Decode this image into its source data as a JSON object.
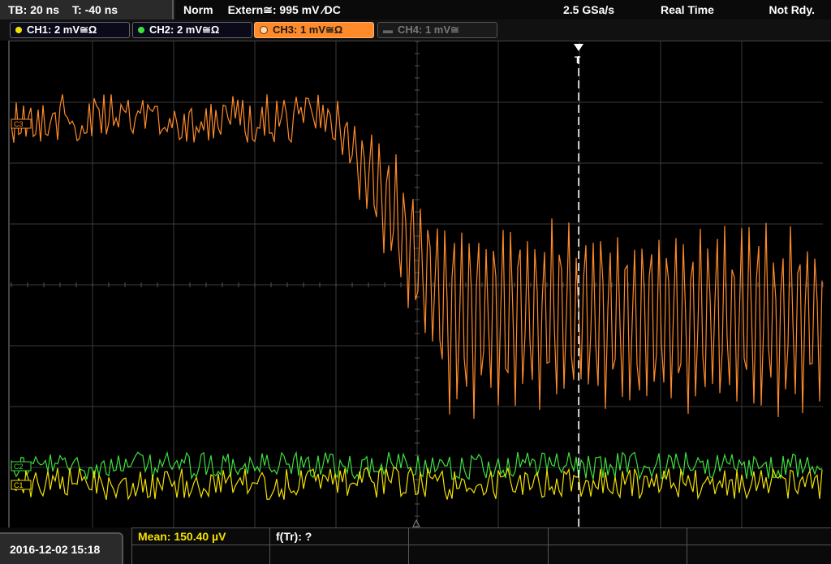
{
  "topbar": {
    "timebase": "TB: 20 ns",
    "trigger_time": "T: -40 ns",
    "mode": "Norm",
    "trigger_source": "Extern≅: 995 mV ⁄DC",
    "sample_rate": "2.5 GSa/s",
    "acq_mode": "Real Time",
    "status": "Not Rdy."
  },
  "channels": [
    {
      "label": "CH1: 2 mV≅Ω",
      "color": "#f3e000",
      "active": true
    },
    {
      "label": "CH2: 2 mV≅Ω",
      "color": "#3ee03e",
      "active": true
    },
    {
      "label": "CH3: 1 mV≅Ω",
      "color": "#ff8a2a",
      "active": true,
      "selected": true
    },
    {
      "label": "CH4: 1 mV≅",
      "color": "#777777",
      "active": false
    }
  ],
  "markers": {
    "ch3_marker": "C3",
    "ch2_marker": "C2",
    "ch1_marker": "C1",
    "trigger_marker": "T"
  },
  "measurements": {
    "mean": "Mean: 150.40 µV",
    "ftr": "f(Tr): ?"
  },
  "datetime": "2016-12-02 15:18",
  "colors": {
    "ch1": "#f3e000",
    "ch2": "#3ee03e",
    "ch3": "#ff8a2a",
    "grid": "#3a3a3a",
    "trigger_line": "#ffffff"
  }
}
